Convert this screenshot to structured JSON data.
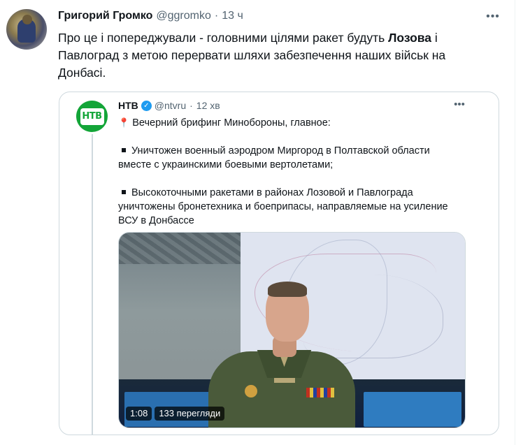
{
  "tweet": {
    "author_name": "Григорий Громко",
    "author_handle": "@ggromko",
    "separator": "·",
    "time": "13 ч",
    "more_label": "•••",
    "text_before": "Про це і попереджували - головними цілями ракет будуть ",
    "text_bold": "Лозова",
    "text_after": " і Павлоград з метою перервати шляхи забезпечення наших військ на Донбасі."
  },
  "quote": {
    "author_name": "НТВ",
    "author_handle": "@ntvru",
    "separator": "·",
    "time": "12 хв",
    "more_label": "•••",
    "avatar_text": "НТВ",
    "verified_mark": "✓",
    "pin_icon": "📍",
    "line1": "Вечерний брифинг Минобороны, главное:",
    "bullet1_line1": "Уничтожен военный аэродром Миргород в Полтавской области",
    "bullet1_line2": "вместе с украинскими боевыми вертолетами;",
    "bullet2_line1": "Высокоточными ракетами в районах Лозовой и Павлограда",
    "bullet2_line2": "уничтожены бронетехника и боеприпасы, направляемые на усиление",
    "bullet2_line3": "ВСУ в Донбассе",
    "video_duration": "1:08",
    "video_views": "133 перегляди"
  },
  "colors": {
    "text_primary": "#0f1419",
    "text_secondary": "#536471",
    "verified_blue": "#1d9bf0",
    "ntv_green": "#13a538",
    "border": "#cfd9de"
  },
  "icons": {
    "more": "more-horizontal-icon",
    "verified": "verified-badge-icon",
    "pin": "round-pushpin-icon"
  }
}
